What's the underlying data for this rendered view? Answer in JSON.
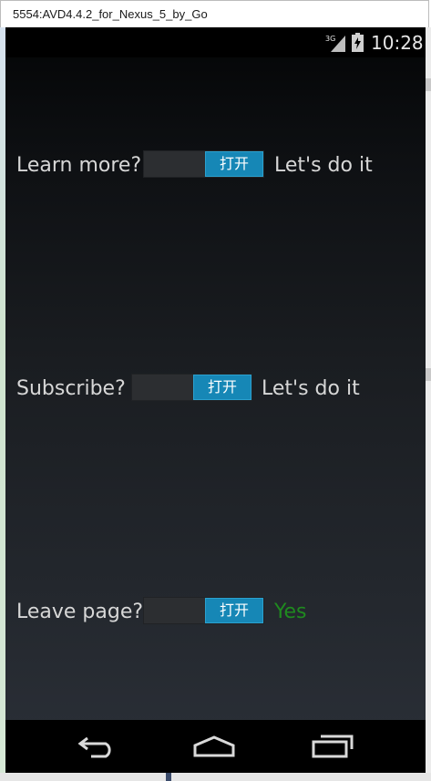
{
  "window": {
    "title": "5554:AVD4.4.2_for_Nexus_5_by_Go"
  },
  "statusbar": {
    "time": "10:28",
    "network": "3G"
  },
  "rows": [
    {
      "label": "Learn more?",
      "toggle_label": "打开",
      "status": "Let's do it",
      "status_color": "#d7d7d7"
    },
    {
      "label": "Subscribe?",
      "toggle_label": "打开",
      "status": "Let's do it",
      "status_color": "#d7d7d7"
    },
    {
      "label": "Leave page?",
      "toggle_label": "打开",
      "status": "Yes",
      "status_color": "#1f8a1f"
    }
  ],
  "navbar": {
    "icons": [
      "back-icon",
      "home-icon",
      "recent-apps-icon"
    ]
  },
  "colors": {
    "switch_on": "#1687b6",
    "screen_top": "#040506",
    "screen_bottom": "#2b3038"
  }
}
